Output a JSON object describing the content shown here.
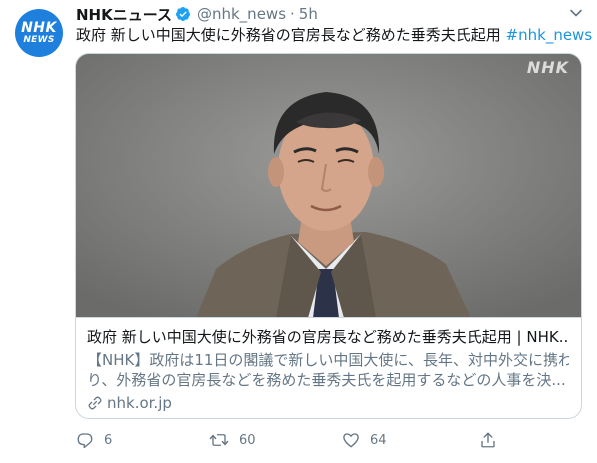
{
  "tweet": {
    "author_name": "NHKニュース",
    "handle": "@nhk_news",
    "separator": "·",
    "time": "5h",
    "text": "政府 新しい中国大使に外務省の官房長など務めた垂秀夫氏起用 ",
    "hashtag": "#nhk_news"
  },
  "avatar": {
    "line1": "NHK",
    "line2": "NEWS"
  },
  "card": {
    "watermark": "NHK",
    "title": "政府 新しい中国大使に外務省の官房長など務めた垂秀夫氏起用 | NHK...",
    "description_line1": "【NHK】政府は11日の閣議で新しい中国大使に、長年、対中外交に携わ",
    "description_line2": "り、外務省の官房長などを務めた垂秀夫氏を起用するなどの人事を決...",
    "domain": "nhk.or.jp"
  },
  "actions": {
    "reply_count": "6",
    "retweet_count": "60",
    "like_count": "64"
  },
  "colors": {
    "accent": "#1b95e0",
    "avatar_bg": "#1f7fdc",
    "secondary_text": "#657786"
  }
}
